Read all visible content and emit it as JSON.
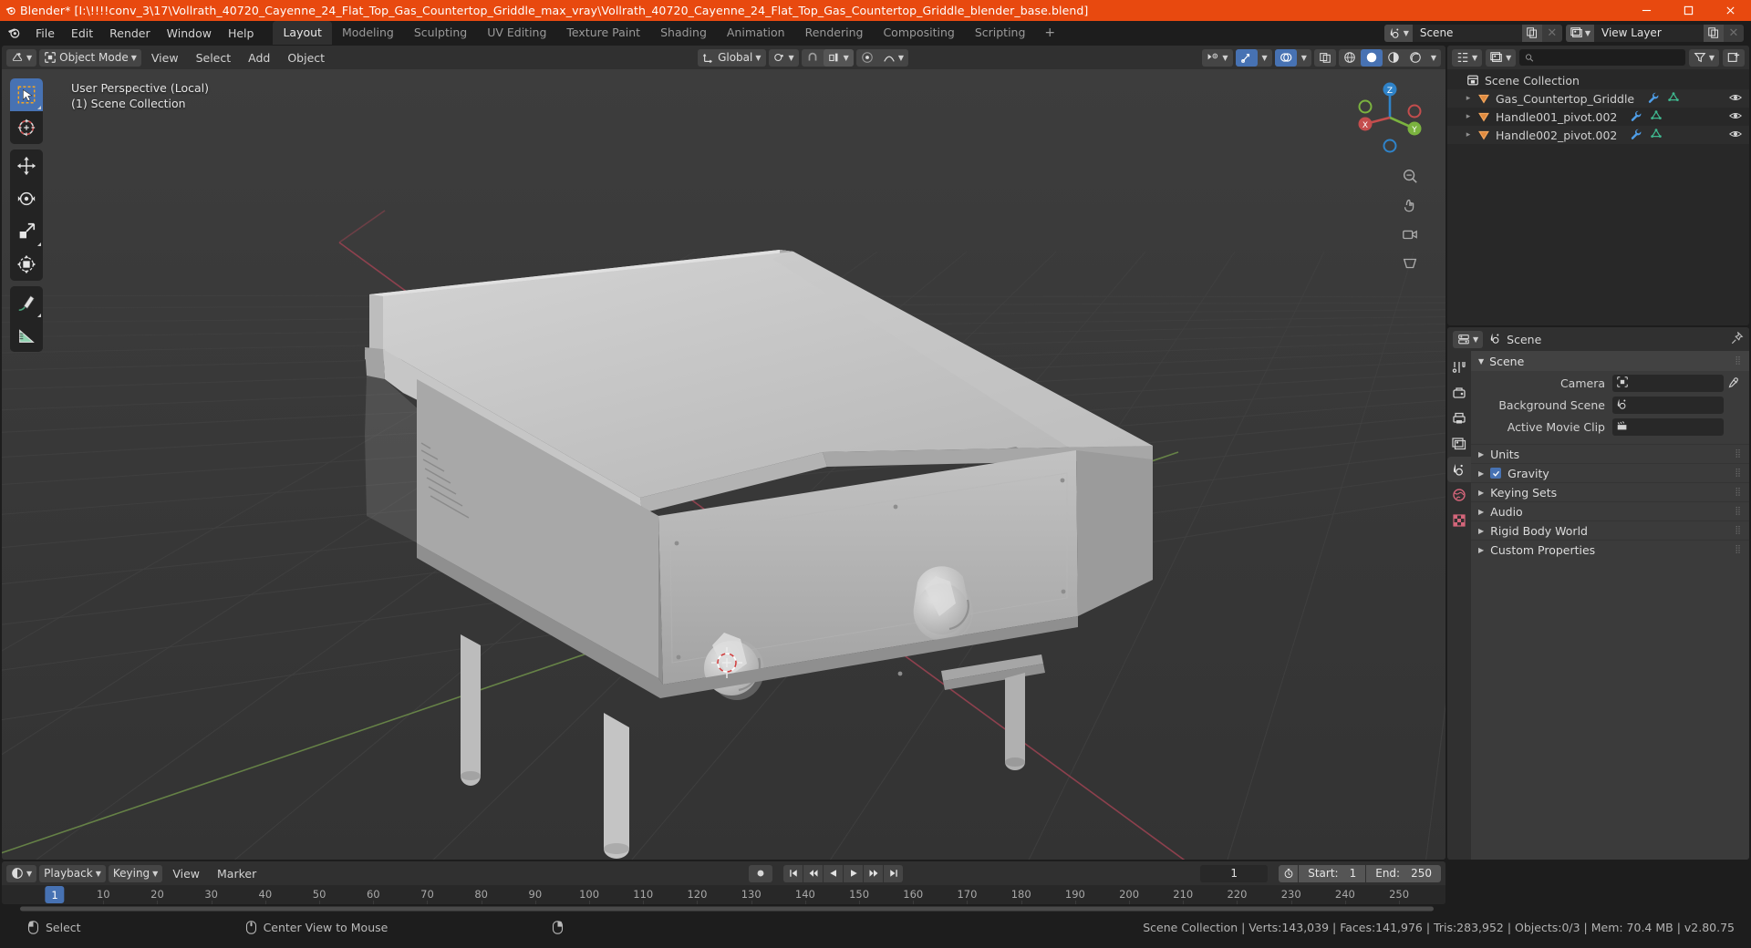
{
  "titlebar": {
    "app_title": "Blender* [I:\\!!!!conv_3\\17\\Vollrath_40720_Cayenne_24_Flat_Top_Gas_Countertop_Griddle_max_vray\\Vollrath_40720_Cayenne_24_Flat_Top_Gas_Countertop_Griddle_blender_base.blend]",
    "icon": "blender-icon",
    "minimize": "minimize-icon",
    "maximize": "maximize-icon",
    "close": "close-icon",
    "accent_color": "#e8490f"
  },
  "topbar": {
    "logo": "blender-logo-icon",
    "menus": [
      "File",
      "Edit",
      "Render",
      "Window",
      "Help"
    ],
    "workspaces": [
      {
        "label": "Layout",
        "active": true
      },
      {
        "label": "Modeling",
        "active": false
      },
      {
        "label": "Sculpting",
        "active": false
      },
      {
        "label": "UV Editing",
        "active": false
      },
      {
        "label": "Texture Paint",
        "active": false
      },
      {
        "label": "Shading",
        "active": false
      },
      {
        "label": "Animation",
        "active": false
      },
      {
        "label": "Rendering",
        "active": false
      },
      {
        "label": "Compositing",
        "active": false
      },
      {
        "label": "Scripting",
        "active": false
      }
    ],
    "add_workspace": "+",
    "scene_selector": {
      "icon": "scene-icon",
      "value": "Scene",
      "new_btn": "duplicate-icon",
      "unlink_btn": "x-icon"
    },
    "viewlayer_selector": {
      "icon": "view-layer-icon",
      "value": "View Layer",
      "new_btn": "duplicate-icon",
      "unlink_btn": "x-icon"
    }
  },
  "viewport": {
    "header": {
      "editor_type": "editor-type-icon",
      "mode": "Object Mode",
      "menus": [
        "View",
        "Select",
        "Add",
        "Object"
      ],
      "transform_orientation": "Global",
      "snapping": "snap-magnet-icon",
      "proportional_edit": "proportional-edit-icon",
      "visibility": "show-gizmo-icon",
      "shading_modes": [
        "wireframe",
        "solid",
        "material-preview",
        "rendered"
      ],
      "active_shading": "solid"
    },
    "overlay_text_line1": "User Perspective (Local)",
    "overlay_text_line2": "(1) Scene Collection",
    "tools": [
      {
        "name": "tweak-select-box",
        "active": true
      },
      {
        "name": "cursor-tool",
        "active": false
      },
      {
        "name": "move-tool",
        "active": false
      },
      {
        "name": "rotate-tool",
        "active": false
      },
      {
        "name": "scale-tool",
        "active": false
      },
      {
        "name": "transform-tool",
        "active": false
      },
      {
        "name": "annotate-tool",
        "active": false
      },
      {
        "name": "measure-tool",
        "active": false
      }
    ],
    "gizmo_axes": [
      "X",
      "Y",
      "Z"
    ],
    "background_color": "#393939",
    "object_color": "#b5b5b5"
  },
  "outliner": {
    "display_mode": "view-layer-icon",
    "filter_icon": "filter-icon",
    "new_collection_icon": "new-collection-icon",
    "search_placeholder": "",
    "root": "Scene Collection",
    "items": [
      {
        "label": "Gas_Countertop_Griddle",
        "icon": "mesh-object-icon",
        "modifier": "wrench-icon",
        "data": "mesh-data-icon",
        "visibility": "eye-icon"
      },
      {
        "label": "Handle001_pivot.002",
        "icon": "mesh-object-icon",
        "modifier": "wrench-icon",
        "data": "mesh-data-icon",
        "visibility": "eye-icon"
      },
      {
        "label": "Handle002_pivot.002",
        "icon": "mesh-object-icon",
        "modifier": "wrench-icon",
        "data": "mesh-data-icon",
        "visibility": "eye-icon"
      }
    ]
  },
  "properties": {
    "breadcrumb_icon": "scene-props-icon",
    "breadcrumb": "Scene",
    "pin_icon": "pin-icon",
    "tabs": [
      {
        "name": "tool-tab",
        "active": false
      },
      {
        "name": "render-tab",
        "active": false
      },
      {
        "name": "output-tab",
        "active": false
      },
      {
        "name": "view-layer-tab",
        "active": false
      },
      {
        "name": "scene-tab",
        "active": true
      },
      {
        "name": "world-tab",
        "active": false
      },
      {
        "name": "texture-tab",
        "active": false
      }
    ],
    "panel_title": "Scene",
    "fields": [
      {
        "label": "Camera",
        "value": "",
        "icon": "camera-icon",
        "has_eyedropper": true
      },
      {
        "label": "Background Scene",
        "value": "",
        "icon": "scene-icon",
        "has_eyedropper": false
      },
      {
        "label": "Active Movie Clip",
        "value": "",
        "icon": "clip-icon",
        "has_eyedropper": false
      }
    ],
    "sections": [
      {
        "label": "Units",
        "checkbox": false,
        "expanded": false
      },
      {
        "label": "Gravity",
        "checkbox": true,
        "expanded": false
      },
      {
        "label": "Keying Sets",
        "checkbox": false,
        "expanded": false
      },
      {
        "label": "Audio",
        "checkbox": false,
        "expanded": false
      },
      {
        "label": "Rigid Body World",
        "checkbox": false,
        "expanded": false
      },
      {
        "label": "Custom Properties",
        "checkbox": false,
        "expanded": false
      }
    ]
  },
  "timeline": {
    "editor_icon": "timeline-icon",
    "menus": [
      "Playback",
      "Keying",
      "View",
      "Marker"
    ],
    "transport": [
      "jump-start",
      "prev-keyframe",
      "play-reverse",
      "play",
      "next-keyframe",
      "jump-end"
    ],
    "record_icon": "record-icon",
    "current_frame": "1",
    "frame_indicator_label": "1",
    "start_label": "Start:",
    "start_value": "1",
    "end_label": "End:",
    "end_value": "250",
    "auto_key_icon": "stopwatch-icon",
    "ticks": [
      10,
      20,
      30,
      40,
      50,
      60,
      70,
      80,
      90,
      100,
      110,
      120,
      130,
      140,
      150,
      160,
      170,
      180,
      190,
      200,
      210,
      220,
      230,
      240,
      250
    ]
  },
  "statusbar": {
    "mouse_hints": [
      {
        "icon": "mouse-left-icon",
        "label": "Select"
      },
      {
        "icon": "mouse-middle-icon",
        "label": "Center View to Mouse"
      },
      {
        "icon": "mouse-right-icon",
        "label": ""
      }
    ],
    "stats": "Scene Collection | Verts:143,039 | Faces:141,976 | Tris:283,952 | Objects:0/3 | Mem: 70.4 MB | v2.80.75"
  }
}
